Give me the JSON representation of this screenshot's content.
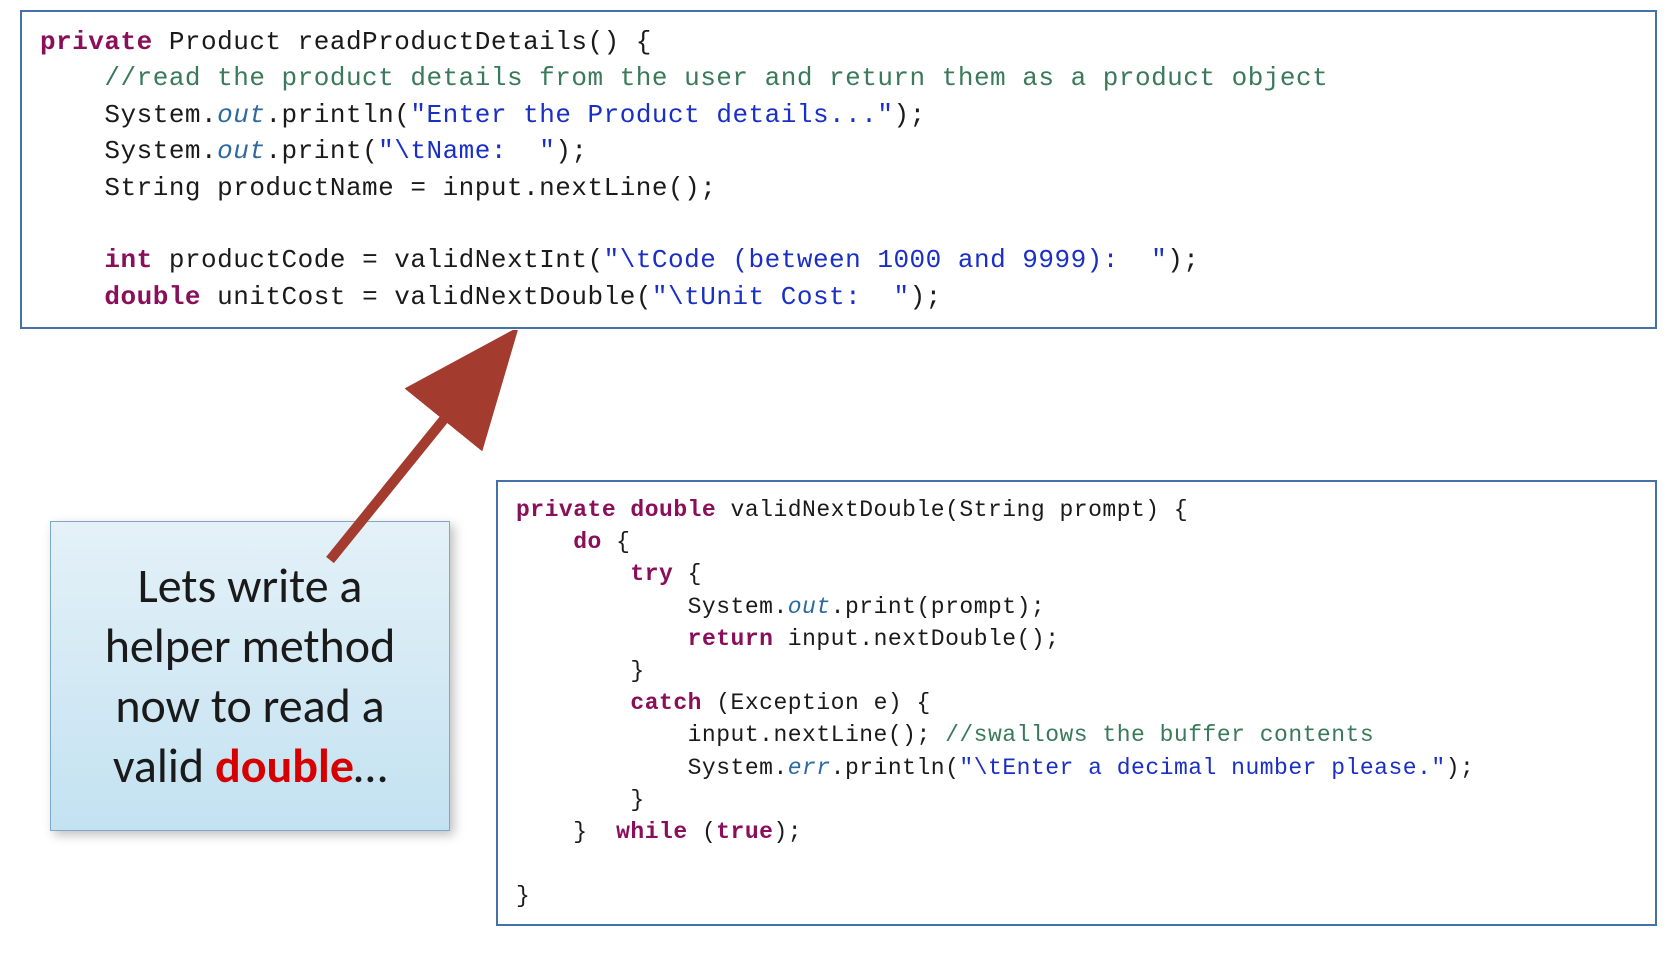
{
  "topCode": {
    "l1a": "private",
    "l1b": " Product readProductDetails() {",
    "l2": "    //read the product details from the user and return them as a product object",
    "l3a": "    System.",
    "l3b": "out",
    "l3c": ".println(",
    "l3d": "\"Enter the Product details...\"",
    "l3e": ");",
    "l4a": "    System.",
    "l4b": "out",
    "l4c": ".print(",
    "l4d": "\"\\tName:  \"",
    "l4e": ");",
    "l5": "    String productName = input.nextLine();",
    "blank": "",
    "l6a": "    ",
    "l6b": "int",
    "l6c": " productCode = validNextInt(",
    "l6d": "\"\\tCode (between 1000 and 9999):  \"",
    "l6e": ");",
    "l7a": "    ",
    "l7b": "double",
    "l7c": " unitCost = validNextDouble(",
    "l7d": "\"\\tUnit Cost:  \"",
    "l7e": ");"
  },
  "bottomCode": {
    "l1a": "private double",
    "l1b": " validNextDouble(String prompt) {",
    "l2a": "    ",
    "l2b": "do",
    "l2c": " {",
    "l3a": "        ",
    "l3b": "try",
    "l3c": " {",
    "l4a": "            System.",
    "l4b": "out",
    "l4c": ".print(prompt);",
    "l5a": "            ",
    "l5b": "return",
    "l5c": " input.nextDouble();",
    "l6": "        }",
    "l7a": "        ",
    "l7b": "catch",
    "l7c": " (Exception e) {",
    "l8a": "            input.nextLine(); ",
    "l8b": "//swallows the buffer contents",
    "l9a": "            System.",
    "l9b": "err",
    "l9c": ".println(",
    "l9d": "\"\\tEnter a decimal number please.\"",
    "l9e": ");",
    "l10": "        }",
    "l11a": "    }  ",
    "l11b": "while",
    "l11c": " (",
    "l11d": "true",
    "l11e": ");",
    "blank": "",
    "l12": "}"
  },
  "callout": {
    "pre": "Lets write a helper method now to read a valid ",
    "highlight": "double",
    "post": "…"
  }
}
